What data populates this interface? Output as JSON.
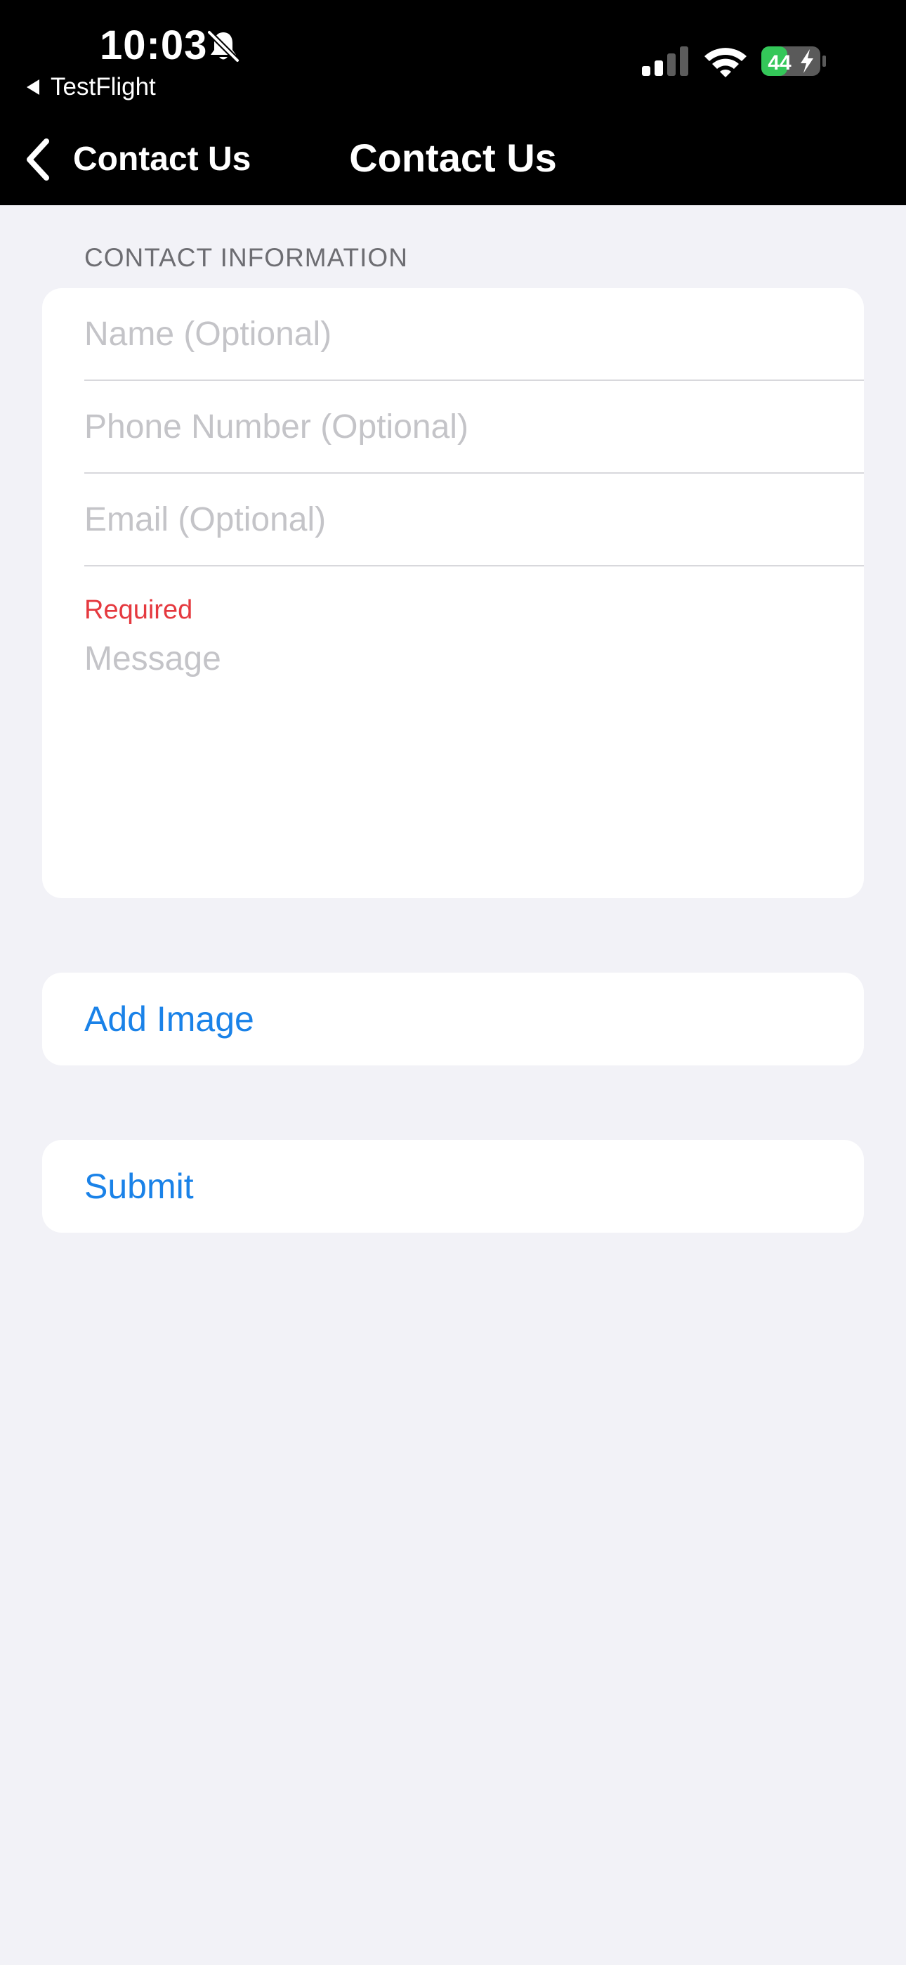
{
  "status_bar": {
    "time": "10:03",
    "back_app_label": "TestFlight",
    "battery_level": "44",
    "battery_fraction": 0.44,
    "colors": {
      "battery_fill": "#34c759",
      "background": "#000000"
    },
    "icons": [
      "bell-slash-icon",
      "signal-icon",
      "wifi-icon",
      "battery-charging-icon"
    ]
  },
  "nav": {
    "back_label": "Contact Us",
    "title": "Contact Us"
  },
  "form": {
    "section_header": "CONTACT INFORMATION",
    "name_placeholder": "Name (Optional)",
    "phone_placeholder": "Phone Number (Optional)",
    "email_placeholder": "Email (Optional)",
    "required_label": "Required",
    "message_placeholder": "Message"
  },
  "actions": {
    "add_image_label": "Add Image",
    "submit_label": "Submit"
  },
  "colors": {
    "accent": "#1a82e8",
    "required": "#e5393f",
    "background": "#f2f2f7",
    "card": "#ffffff"
  }
}
